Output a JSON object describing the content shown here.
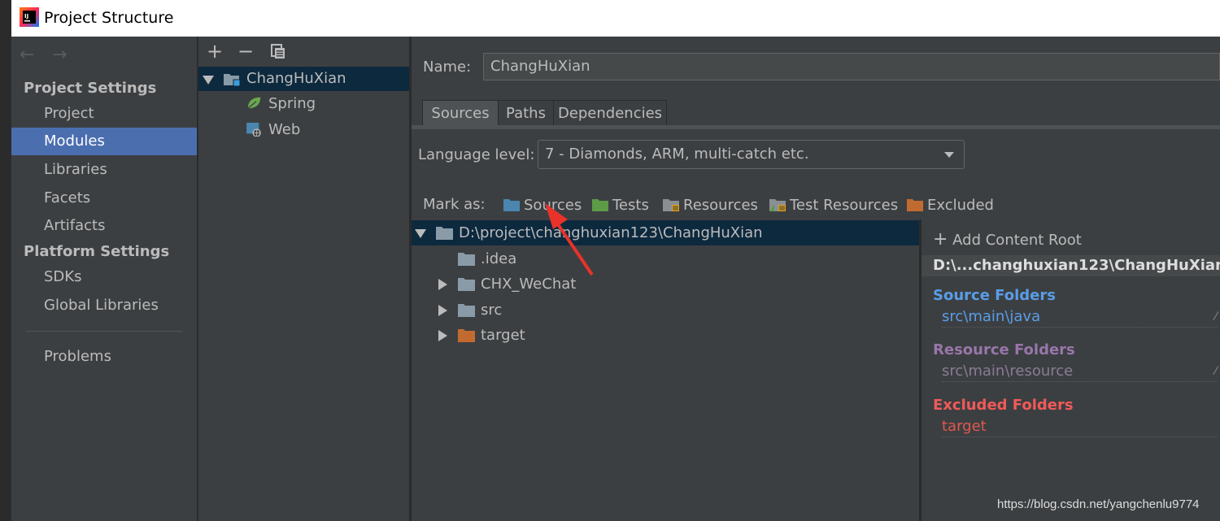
{
  "window": {
    "title": "Project Structure"
  },
  "sidebar": {
    "project_settings_header": "Project Settings",
    "platform_settings_header": "Platform Settings",
    "items": [
      {
        "label": "Project"
      },
      {
        "label": "Modules",
        "selected": true
      },
      {
        "label": "Libraries"
      },
      {
        "label": "Facets"
      },
      {
        "label": "Artifacts"
      },
      {
        "label": "SDKs"
      },
      {
        "label": "Global Libraries"
      },
      {
        "label": "Problems"
      }
    ]
  },
  "module_tree": {
    "toolbar": {
      "add": "+",
      "remove": "−"
    },
    "root": "ChangHuXian",
    "children": [
      "Spring",
      "Web"
    ]
  },
  "main": {
    "name_label": "Name:",
    "name_value": "ChangHuXian",
    "tabs": [
      {
        "label": "Sources",
        "active": true
      },
      {
        "label": "Paths"
      },
      {
        "label": "Dependencies"
      }
    ],
    "language_label": "Language level:",
    "language_value": "7 - Diamonds, ARM, multi-catch etc.",
    "mark_as_label": "Mark as:",
    "mark_buttons": [
      {
        "label": "Sources",
        "color": "#4a86b0"
      },
      {
        "label": "Tests",
        "color": "#5d9b47"
      },
      {
        "label": "Resources",
        "color": "#8a8f94"
      },
      {
        "label": "Test Resources",
        "color": "#8a8f94"
      },
      {
        "label": "Excluded",
        "color": "#c26b30"
      }
    ],
    "content_tree": {
      "root": "D:\\project\\changhuxian123\\ChangHuXian",
      "children": [
        ".idea",
        "CHX_WeChat",
        "src",
        "target"
      ]
    },
    "right_panel": {
      "add_content_root": "Add Content Root",
      "root_path": "D:\\...changhuxian123\\ChangHuXian",
      "source_folders_header": "Source Folders",
      "source_folder": "src\\main\\java",
      "resource_folders_header": "Resource Folders",
      "resource_folder": "src\\main\\resource",
      "excluded_folders_header": "Excluded Folders",
      "excluded_folder": "target"
    }
  },
  "colors": {
    "selection": "#4b6eaf",
    "tree_selection": "#0d293e",
    "source_header": "#5a9de8",
    "resource_header": "#9876aa",
    "excluded_header": "#f05a5a",
    "annotation_arrow": "#e8322a"
  },
  "watermark": "https://blog.csdn.net/yangchenlu9774"
}
